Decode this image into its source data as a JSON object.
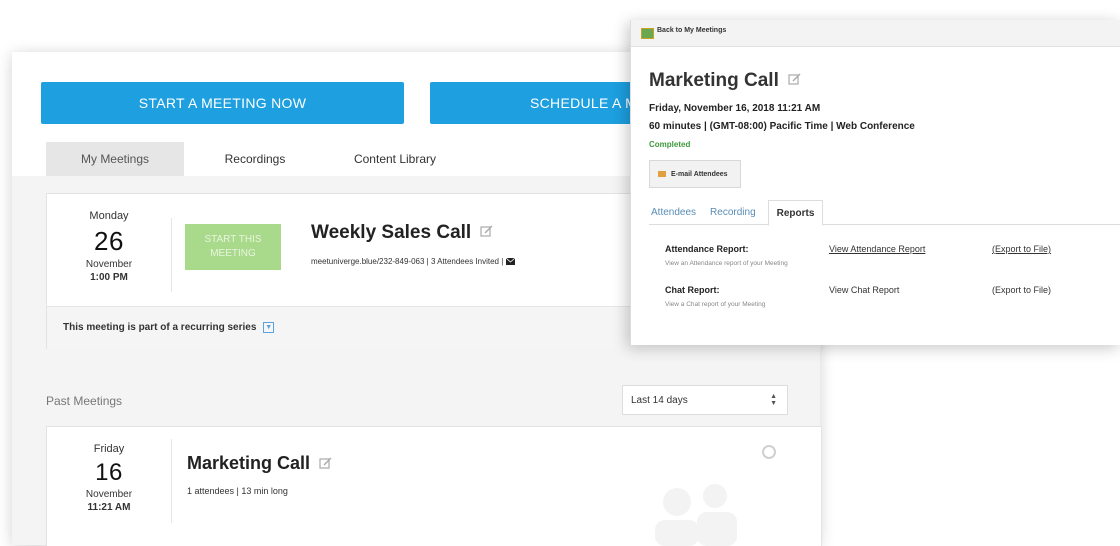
{
  "main": {
    "start_button": "START A MEETING NOW",
    "schedule_button": "SCHEDULE A M",
    "tabs": [
      "My Meetings",
      "Recordings",
      "Content Library"
    ],
    "upcoming": {
      "day": "Monday",
      "date_num": "26",
      "month": "November",
      "time": "1:00 PM",
      "start_label": "START THIS MEETING",
      "title": "Weekly Sales Call",
      "meta": "meetuniverge.blue/232-849-063 | 3 Attendees Invited |",
      "recurring": "This meeting is part of a recurring series"
    },
    "past_label": "Past Meetings",
    "range_select": "Last 14 days",
    "past": {
      "day": "Friday",
      "date_num": "16",
      "month": "November",
      "time": "11:21 AM",
      "title": "Marketing Call",
      "meta": "1 attendees | 13 min long"
    }
  },
  "overlay": {
    "back_link": "Back to My Meetings",
    "title": "Marketing Call",
    "datetime": "Friday, November 16, 2018 11:21 AM",
    "details": "60 minutes | (GMT-08:00) Pacific Time | Web Conference",
    "status": "Completed",
    "email_button": "E-mail Attendees",
    "tabs": [
      "Attendees",
      "Recording",
      "Reports"
    ],
    "reports": [
      {
        "name": "Attendance Report:",
        "desc": "View an Attendance report of your Meeting",
        "view": "View Attendance Report",
        "export": "(Export to File)"
      },
      {
        "name": "Chat Report:",
        "desc": "View a Chat report of your Meeting",
        "view": "View Chat Report",
        "export": "(Export to File)"
      }
    ]
  },
  "colors": {
    "primary_button": "#1d9fe0",
    "start_disabled": "#a9d98a",
    "completed": "#3d9a3d"
  }
}
